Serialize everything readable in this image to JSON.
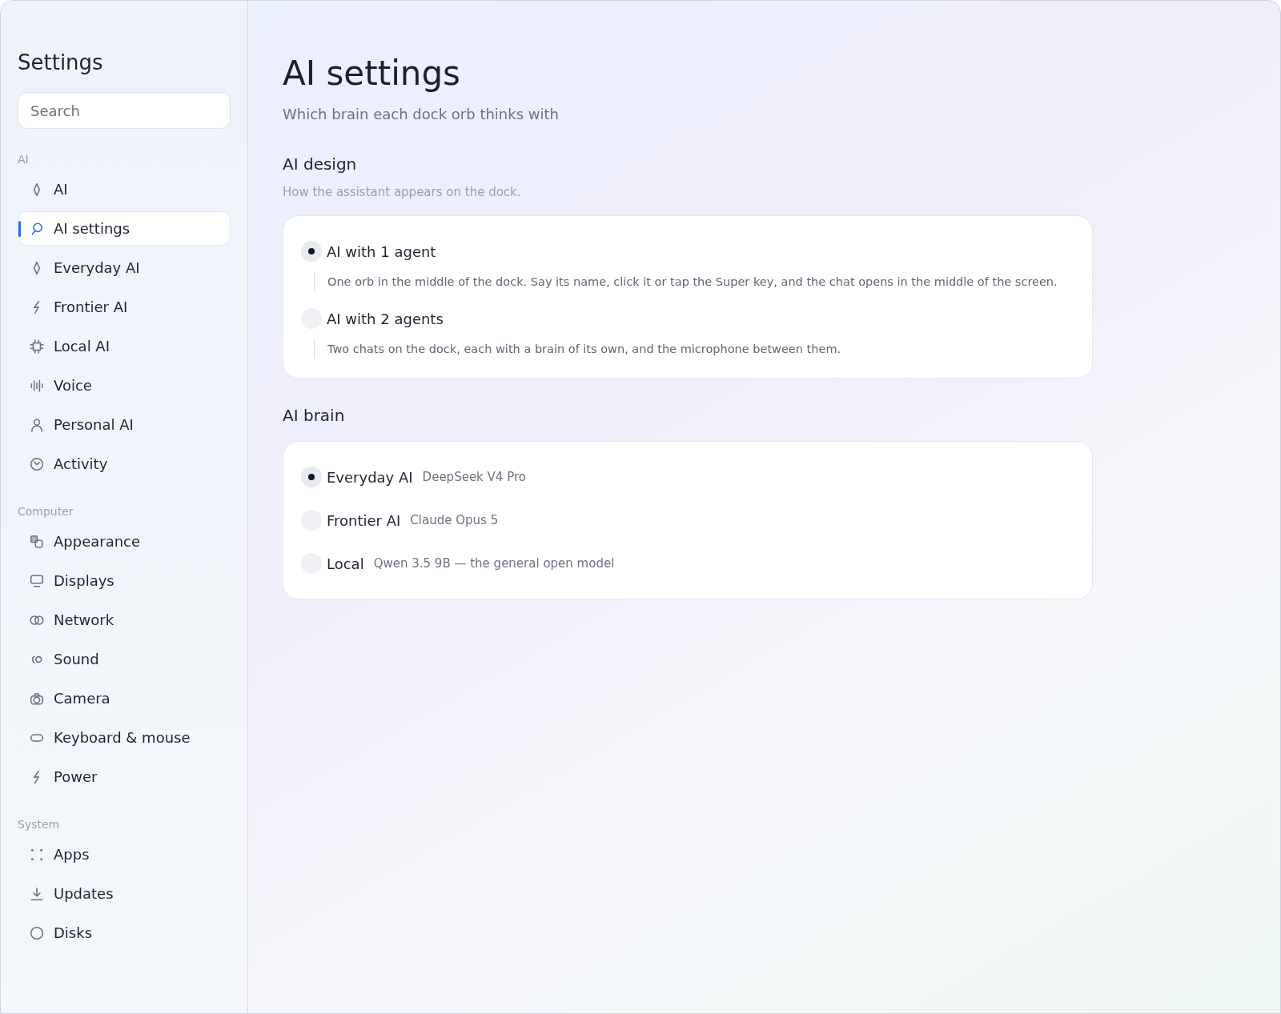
{
  "sidebar": {
    "title": "Settings",
    "search": {
      "placeholder": "Search"
    },
    "sections": [
      {
        "heading": "AI",
        "items": [
          {
            "label": "AI",
            "selected": false
          },
          {
            "label": "AI settings",
            "selected": true
          },
          {
            "label": "Everyday AI",
            "selected": false
          },
          {
            "label": "Frontier AI",
            "selected": false
          },
          {
            "label": "Local AI",
            "selected": false
          },
          {
            "label": "Voice",
            "selected": false
          },
          {
            "label": "Personal AI",
            "selected": false
          },
          {
            "label": "Activity",
            "selected": false
          }
        ]
      },
      {
        "heading": "Computer",
        "items": [
          {
            "label": "Appearance",
            "selected": false
          },
          {
            "label": "Displays",
            "selected": false
          },
          {
            "label": "Network",
            "selected": false
          },
          {
            "label": "Sound",
            "selected": false
          },
          {
            "label": "Camera",
            "selected": false
          },
          {
            "label": "Keyboard & mouse",
            "selected": false
          },
          {
            "label": "Power",
            "selected": false
          }
        ]
      },
      {
        "heading": "System",
        "items": [
          {
            "label": "Apps",
            "selected": false
          },
          {
            "label": "Updates",
            "selected": false
          },
          {
            "label": "Disks",
            "selected": false
          }
        ]
      }
    ]
  },
  "main": {
    "title": "AI settings",
    "subtitle": "Which brain each dock orb thinks with",
    "sections": [
      {
        "heading": "AI design",
        "description": "How the assistant appears on the dock.",
        "options": [
          {
            "label": "AI with 1 agent",
            "description": "One orb in the middle of the dock. Say its name, click it or tap the Super key, and the chat opens in the middle of the screen.",
            "selected": true
          },
          {
            "label": "AI with 2 agents",
            "description": "Two chats on the dock, each with a brain of its own, and the microphone between them.",
            "selected": false
          }
        ]
      },
      {
        "heading": "AI brain",
        "options": [
          {
            "label": "Everyday AI",
            "detail": "DeepSeek V4 Pro",
            "selected": true
          },
          {
            "label": "Frontier AI",
            "detail": "Claude Opus 5",
            "selected": false
          },
          {
            "label": "Local",
            "detail": "Qwen 3.5 9B — the general open model",
            "selected": false
          }
        ]
      }
    ]
  }
}
